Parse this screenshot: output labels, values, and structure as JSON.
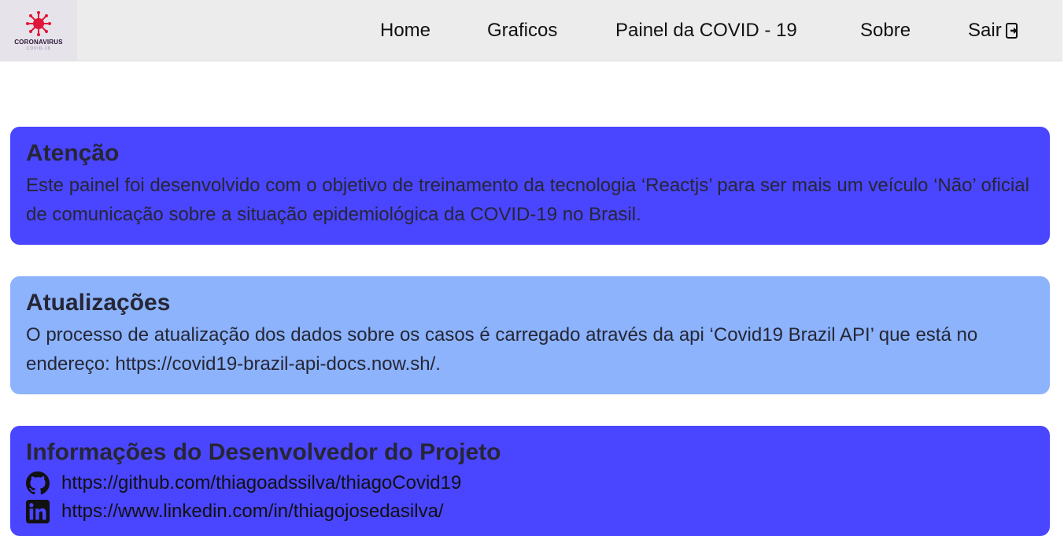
{
  "logo": {
    "title": "CORONAVIRUS",
    "subtitle": "COVID-19"
  },
  "nav": {
    "home": "Home",
    "graficos": "Graficos",
    "painel": "Painel da COVID - 19",
    "sobre": "Sobre",
    "sair": "Sair",
    "sair_icon": "sign-out-icon"
  },
  "cards": {
    "atencao": {
      "title": "Atenção",
      "text": "Este painel foi desenvolvido com o objetivo de treinamento da tecnologia ‘Reactjs’ para ser mais um veículo ‘Não’ oficial de comunicação sobre a situação epidemiológica da COVID-19 no Brasil.",
      "color": "#4a45ff"
    },
    "atualizacoes": {
      "title": "Atualizações",
      "text": "O processo de atualização dos dados sobre os casos é carregado através da api ‘Covid19 Brazil API’ que está no endereço: https://covid19-brazil-api-docs.now.sh/.",
      "color": "#8cb3fc"
    },
    "dev": {
      "title": "Informações do Desenvolvedor do Projeto",
      "links": [
        {
          "icon": "github-icon",
          "url": "https://github.com/thiagoadssilva/thiagoCovid19"
        },
        {
          "icon": "linkedin-icon",
          "url": "https://www.linkedin.com/in/thiagojosedasilva/"
        }
      ]
    }
  }
}
